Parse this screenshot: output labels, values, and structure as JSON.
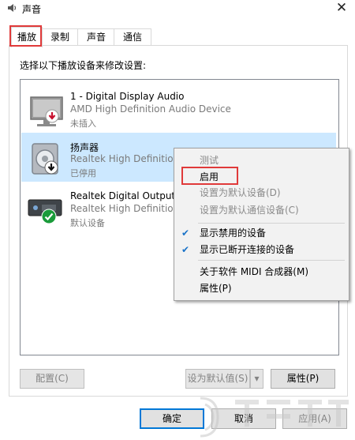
{
  "window": {
    "title": "声音",
    "close_symbol": "✕"
  },
  "tabs": [
    {
      "label": "播放",
      "active": true
    },
    {
      "label": "录制",
      "active": false
    },
    {
      "label": "声音",
      "active": false
    },
    {
      "label": "通信",
      "active": false
    }
  ],
  "instruction": "选择以下播放设备来修改设置:",
  "devices": [
    {
      "name": "1 - Digital Display Audio",
      "description": "AMD High Definition Audio Device",
      "status": "未插入",
      "icon": "monitor-icon",
      "badge": "red-down-arrow"
    },
    {
      "name": "扬声器",
      "description": "Realtek High Definition",
      "status": "已停用",
      "icon": "speaker-icon",
      "badge": "black-down-arrow",
      "selected": true
    },
    {
      "name": "Realtek Digital Output",
      "description": "Realtek High Definition",
      "status": "默认设备",
      "icon": "digital-output-icon",
      "badge": "green-check"
    }
  ],
  "context_menu": [
    {
      "label": "测试",
      "disabled": true
    },
    {
      "label": "启用",
      "disabled": false,
      "highlighted_box": true
    },
    {
      "label": "设置为默认设备(D)",
      "disabled": true
    },
    {
      "label": "设置为默认通信设备(C)",
      "disabled": true
    },
    {
      "label": "显示禁用的设备",
      "checked": true
    },
    {
      "label": "显示已断开连接的设备",
      "checked": true
    },
    {
      "label": "关于软件 MIDI 合成器(M)"
    },
    {
      "label": "属性(P)"
    }
  ],
  "panel_buttons": {
    "configure": "配置(C)",
    "set_default": "设为默认值(S)",
    "properties": "属性(P)"
  },
  "dialog_buttons": {
    "ok": "确定",
    "cancel": "取消",
    "apply": "应用(A)"
  },
  "colors": {
    "selected_row": "#cce8ff",
    "highlight_box": "#e03a3a",
    "check_mark": "#1a73c8",
    "default_button_border": "#0078d7"
  }
}
